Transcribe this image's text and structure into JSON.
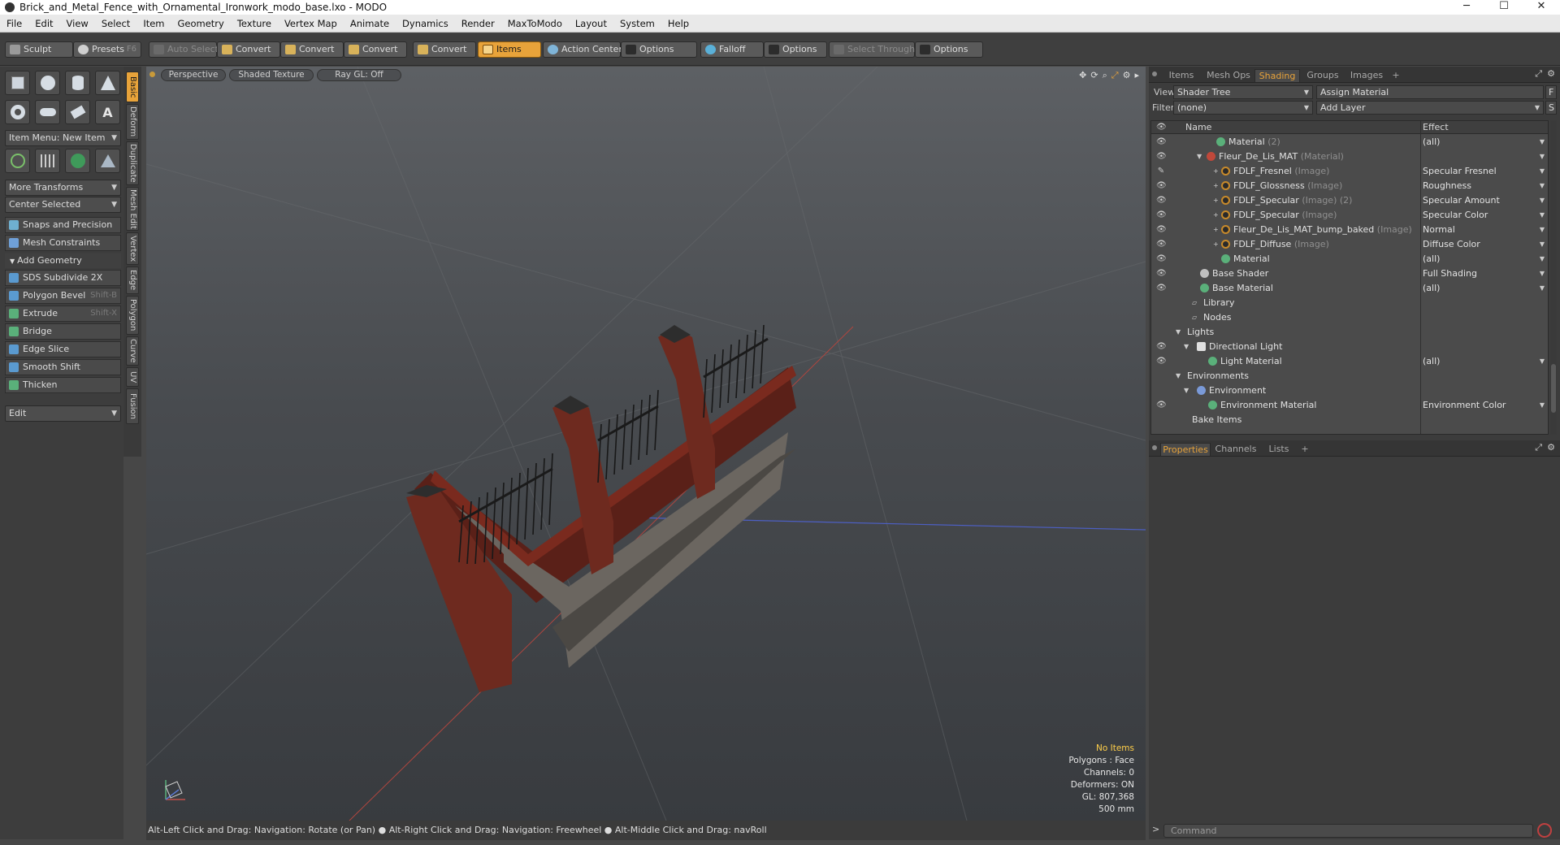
{
  "window": {
    "title": "Brick_and_Metal_Fence_with_Ornamental_Ironwork_modo_base.lxo - MODO",
    "minimize": "─",
    "maximize": "☐",
    "close": "✕"
  },
  "menu": [
    "File",
    "Edit",
    "View",
    "Select",
    "Item",
    "Geometry",
    "Texture",
    "Vertex Map",
    "Animate",
    "Dynamics",
    "Render",
    "MaxToModo",
    "Layout",
    "System",
    "Help"
  ],
  "toolbar": {
    "sculpt": "Sculpt",
    "presets": "Presets",
    "presets_key": "F6",
    "auto_select": "Auto Select",
    "convert": "Convert",
    "items": "Items",
    "action_center": "Action Center",
    "options": "Options",
    "falloff": "Falloff",
    "select_through": "Select Through"
  },
  "left": {
    "item_menu": "Item Menu: New Item",
    "more_transforms": "More Transforms",
    "center_selected": "Center Selected",
    "snaps": "Snaps and Precision",
    "mesh_constraints": "Mesh Constraints",
    "add_geometry": "Add Geometry",
    "tools": [
      {
        "label": "SDS Subdivide 2X",
        "key": ""
      },
      {
        "label": "Polygon Bevel",
        "key": "Shift-B"
      },
      {
        "label": "Extrude",
        "key": "Shift-X"
      },
      {
        "label": "Bridge",
        "key": ""
      },
      {
        "label": "Edge Slice",
        "key": ""
      },
      {
        "label": "Smooth Shift",
        "key": ""
      },
      {
        "label": "Thicken",
        "key": ""
      }
    ],
    "edit": "Edit",
    "vtabs": [
      "Basic",
      "Deform",
      "Duplicate",
      "Mesh Edit",
      "Vertex",
      "Edge",
      "Polygon",
      "Curve",
      "UV",
      "Fusion"
    ]
  },
  "viewport": {
    "view": "Perspective",
    "shading": "Shaded Texture",
    "raygl": "Ray GL: Off",
    "stats": {
      "items": "No Items",
      "polygons": "Polygons : Face",
      "channels": "Channels: 0",
      "deformers": "Deformers: ON",
      "gl": "GL: 807,368",
      "size": "500 mm"
    }
  },
  "status": {
    "hint1": "Alt-Left Click and Drag: Navigation: Rotate (or Pan)",
    "hint2": "Alt-Right Click and Drag: Navigation: Freewheel",
    "hint3": "Alt-Middle Click and Drag: navRoll"
  },
  "right": {
    "tabs": [
      "Items",
      "Mesh Ops",
      "Shading",
      "Groups",
      "Images"
    ],
    "view_label": "View",
    "view_value": "Shader Tree",
    "assign_material": "Assign Material",
    "f_btn": "F",
    "filter_label": "Filter",
    "filter_value": "(none)",
    "add_layer": "Add Layer",
    "s_btn": "S",
    "col_name": "Name",
    "col_effect": "Effect",
    "rows": [
      {
        "name": "Material",
        "type": "(2)",
        "effect": "(all)"
      },
      {
        "name": "Fleur_De_Lis_MAT",
        "type": "(Material)",
        "effect": ""
      },
      {
        "name": "FDLF_Fresnel",
        "type": "(Image)",
        "effect": "Specular Fresnel"
      },
      {
        "name": "FDLF_Glossness",
        "type": "(Image)",
        "effect": "Roughness"
      },
      {
        "name": "FDLF_Specular",
        "type": "(Image) (2)",
        "effect": "Specular Amount"
      },
      {
        "name": "FDLF_Specular",
        "type": "(Image)",
        "effect": "Specular Color"
      },
      {
        "name": "Fleur_De_Lis_MAT_bump_baked",
        "type": "(Image)",
        "effect": "Normal"
      },
      {
        "name": "FDLF_Diffuse",
        "type": "(Image)",
        "effect": "Diffuse Color"
      },
      {
        "name": "Material",
        "type": "",
        "effect": "(all)"
      },
      {
        "name": "Base Shader",
        "type": "",
        "effect": "Full Shading"
      },
      {
        "name": "Base Material",
        "type": "",
        "effect": "(all)"
      },
      {
        "name": "Library",
        "type": "",
        "effect": ""
      },
      {
        "name": "Nodes",
        "type": "",
        "effect": ""
      },
      {
        "name": "Lights",
        "type": "",
        "effect": ""
      },
      {
        "name": "Directional Light",
        "type": "",
        "effect": ""
      },
      {
        "name": "Light Material",
        "type": "",
        "effect": "(all)"
      },
      {
        "name": "Environments",
        "type": "",
        "effect": ""
      },
      {
        "name": "Environment",
        "type": "",
        "effect": ""
      },
      {
        "name": "Environment Material",
        "type": "",
        "effect": "Environment Color"
      },
      {
        "name": "Bake Items",
        "type": "",
        "effect": ""
      }
    ],
    "bottom_tabs": [
      "Properties",
      "Channels",
      "Lists"
    ],
    "command_placeholder": "Command"
  }
}
